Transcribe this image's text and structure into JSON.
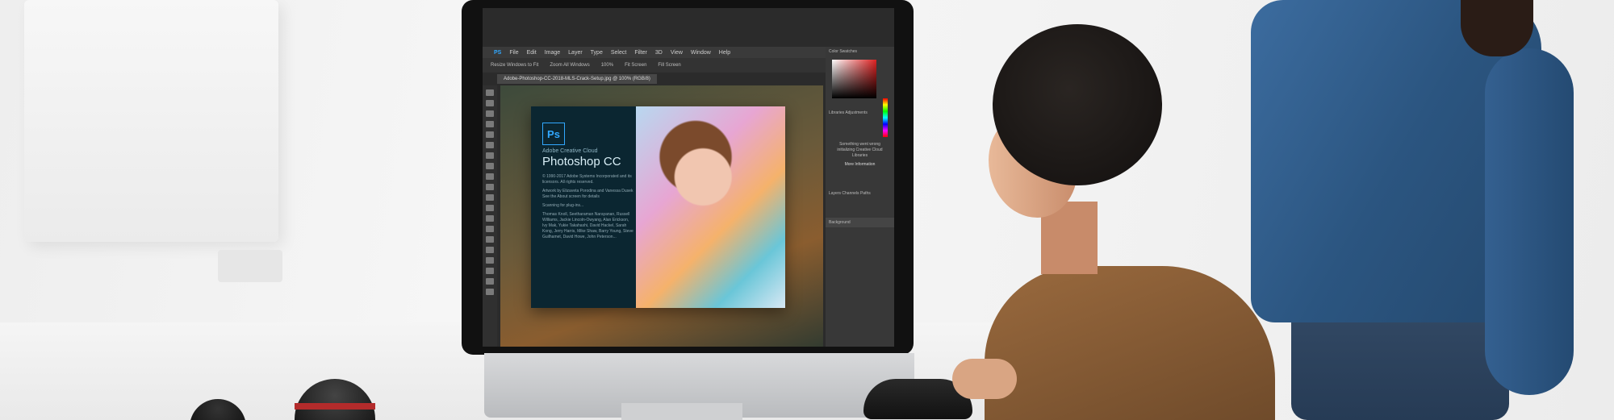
{
  "photoshop": {
    "menu": [
      "PS",
      "File",
      "Edit",
      "Image",
      "Layer",
      "Type",
      "Select",
      "Filter",
      "3D",
      "View",
      "Window",
      "Help"
    ],
    "options": [
      "Resize Windows to Fit",
      "Zoom All Windows",
      "100%",
      "Fit Screen",
      "Fill Screen"
    ],
    "document_tab": "Adobe-Photoshop-CC-2018-MLS-Crack-Setup.jpg @ 100% (RGB/8)",
    "panels": {
      "color_label": "Color",
      "swatches_label": "Swatches",
      "libraries_label": "Libraries",
      "adjustments_label": "Adjustments",
      "cc_message": "Something went wrong initializing Creative Cloud Libraries",
      "more_info": "More Information",
      "layers_label": "Layers",
      "channels_label": "Channels",
      "paths_label": "Paths",
      "background_layer": "Background"
    },
    "splash": {
      "logo": "Ps",
      "brand": "Adobe Creative Cloud",
      "title": "Photoshop CC",
      "copyright": "© 1990-2017 Adobe Systems Incorporated and its licensors. All rights reserved.",
      "artwork": "Artwork by Elizaveta Porodina and Vanessa Dusek",
      "legal": "See the About screen for details",
      "status": "Scanning for plug-ins...",
      "credits": "Thomas Knoll, Seetharaman Narayanan, Russell Williams, Jackie Lincoln-Owyang, Alan Erickson, Ivy Mak, Yukie Takahashi, David Hackel, Sarah Kong, Jerry Harris, Mike Shaw, Barry Young, Steve Guilhamet, David Howe, John Peterson..."
    }
  },
  "colors": {
    "ps_accent": "#31a8ff",
    "splash_bg": "#0b2631",
    "ps_dark": "#2b2b2b"
  }
}
